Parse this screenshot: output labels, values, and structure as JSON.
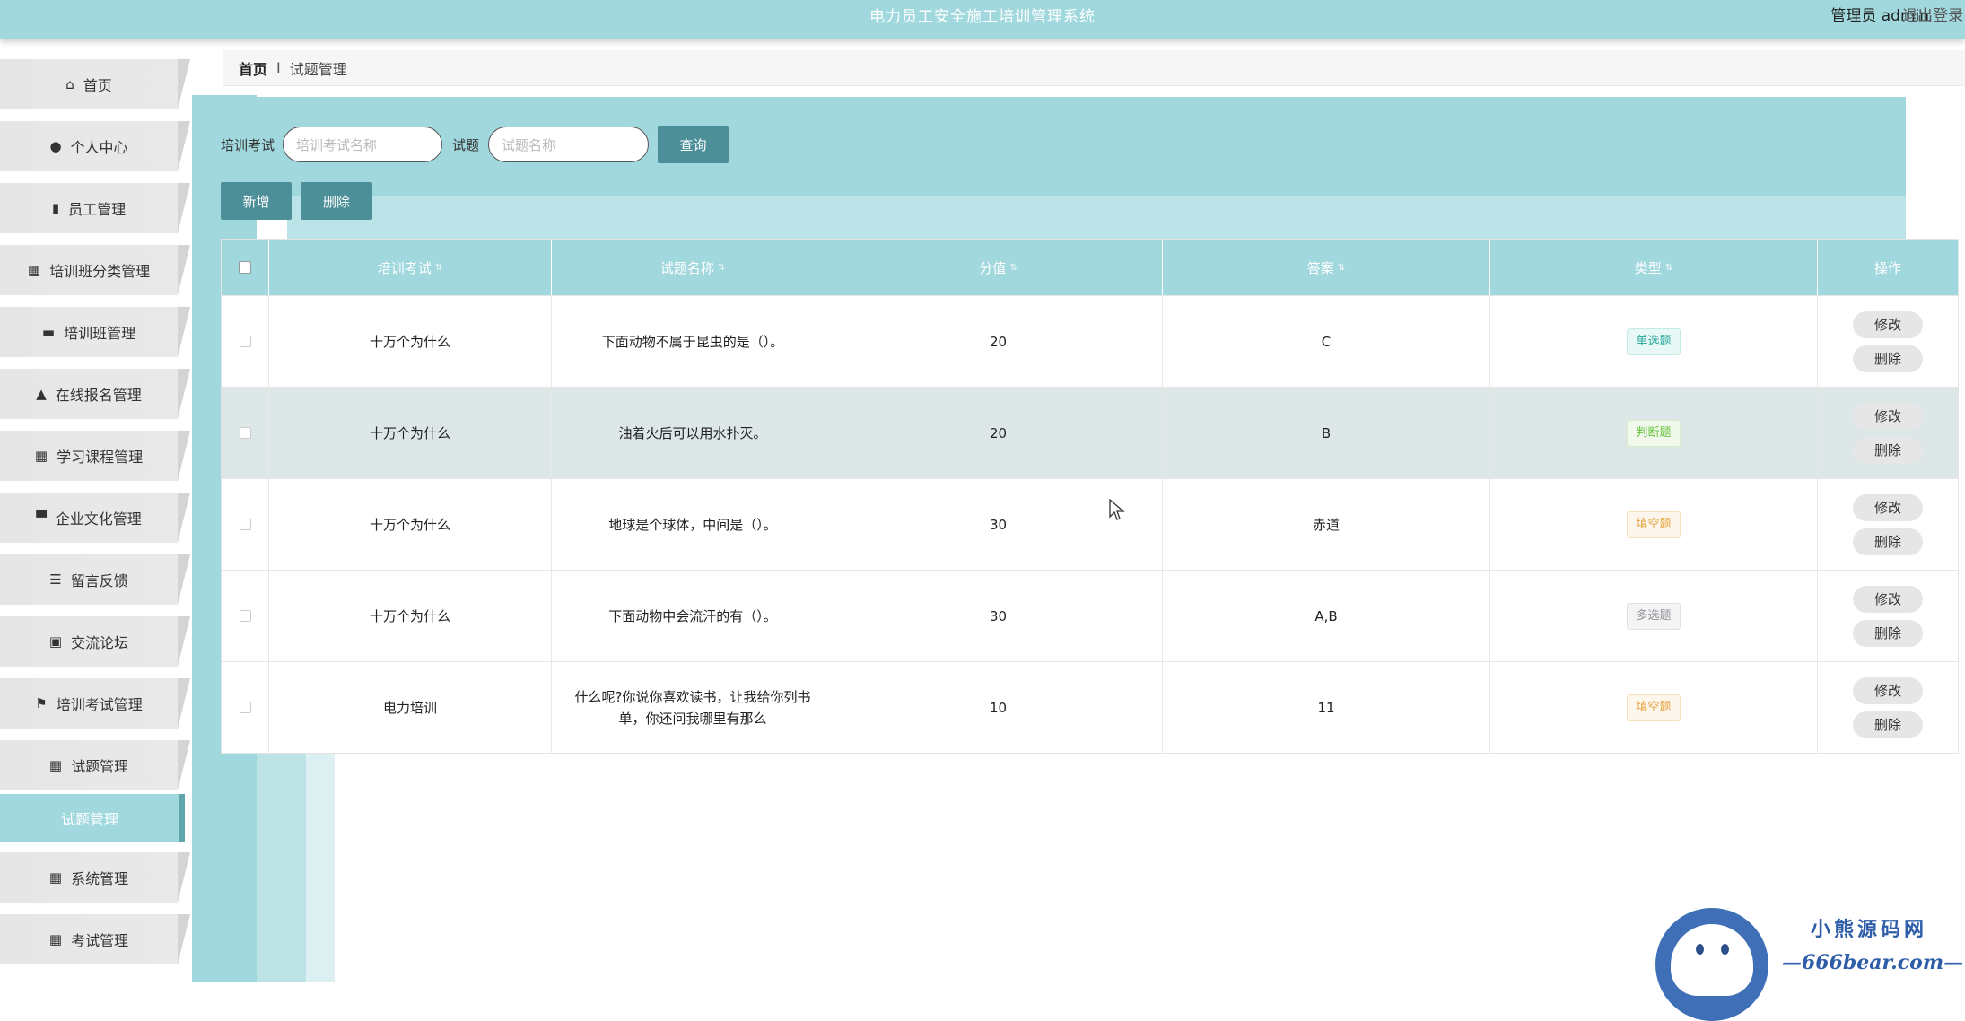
{
  "header": {
    "title": "电力员工安全施工培训管理系统",
    "user": "管理员 admin",
    "logout": "退出登录"
  },
  "sidebar": {
    "items": [
      {
        "label": "首页",
        "icon": "home-icon"
      },
      {
        "label": "个人中心",
        "icon": "user-icon"
      },
      {
        "label": "员工管理",
        "icon": "bar-chart-icon"
      },
      {
        "label": "培训班分类管理",
        "icon": "grid-icon"
      },
      {
        "label": "培训班管理",
        "icon": "chat-icon"
      },
      {
        "label": "在线报名管理",
        "icon": "person-icon"
      },
      {
        "label": "学习课程管理",
        "icon": "grid-icon"
      },
      {
        "label": "企业文化管理",
        "icon": "monitor-icon"
      },
      {
        "label": "留言反馈",
        "icon": "list-icon"
      },
      {
        "label": "交流论坛",
        "icon": "clipboard-icon"
      },
      {
        "label": "培训考试管理",
        "icon": "flag-icon"
      },
      {
        "label": "试题管理",
        "icon": "grid-icon"
      }
    ],
    "active_sub": "试题管理",
    "items_after": [
      {
        "label": "系统管理",
        "icon": "grid-icon"
      },
      {
        "label": "考试管理",
        "icon": "grid-icon"
      }
    ]
  },
  "breadcrumb": {
    "home": "首页",
    "separator": "I",
    "current": "试题管理"
  },
  "search": {
    "exam_label": "培训考试",
    "exam_placeholder": "培训考试名称",
    "question_label": "试题",
    "question_placeholder": "试题名称",
    "query_button": "查询",
    "add_button": "新增",
    "delete_button": "删除"
  },
  "table": {
    "headers": [
      "培训考试",
      "试题名称",
      "分值",
      "答案",
      "类型",
      "操作"
    ],
    "rows": [
      {
        "exam": "十万个为什么",
        "question": "下面动物不属于昆虫的是（）。",
        "score": "20",
        "answer": "C",
        "type": "单选题",
        "type_style": "single"
      },
      {
        "exam": "十万个为什么",
        "question": "油着火后可以用水扑灭。",
        "score": "20",
        "answer": "B",
        "type": "判断题",
        "type_style": "judge"
      },
      {
        "exam": "十万个为什么",
        "question": "地球是个球体，中间是（）。",
        "score": "30",
        "answer": "赤道",
        "type": "填空题",
        "type_style": "fill"
      },
      {
        "exam": "十万个为什么",
        "question": "下面动物中会流汗的有（）。",
        "score": "30",
        "answer": "A,B",
        "type": "多选题",
        "type_style": "multi"
      },
      {
        "exam": "电力培训",
        "question": "什么呢?你说你喜欢读书，让我给你列书单，你还问我哪里有那么",
        "score": "10",
        "answer": "11",
        "type": "填空题",
        "type_style": "fill"
      }
    ],
    "edit_label": "修改",
    "delete_label": "删除"
  },
  "watermark": {
    "line1": "小熊源码网",
    "line2": "—666bear.com—"
  },
  "colors": {
    "accent": "#a0d8de",
    "button": "#4d8f98"
  }
}
